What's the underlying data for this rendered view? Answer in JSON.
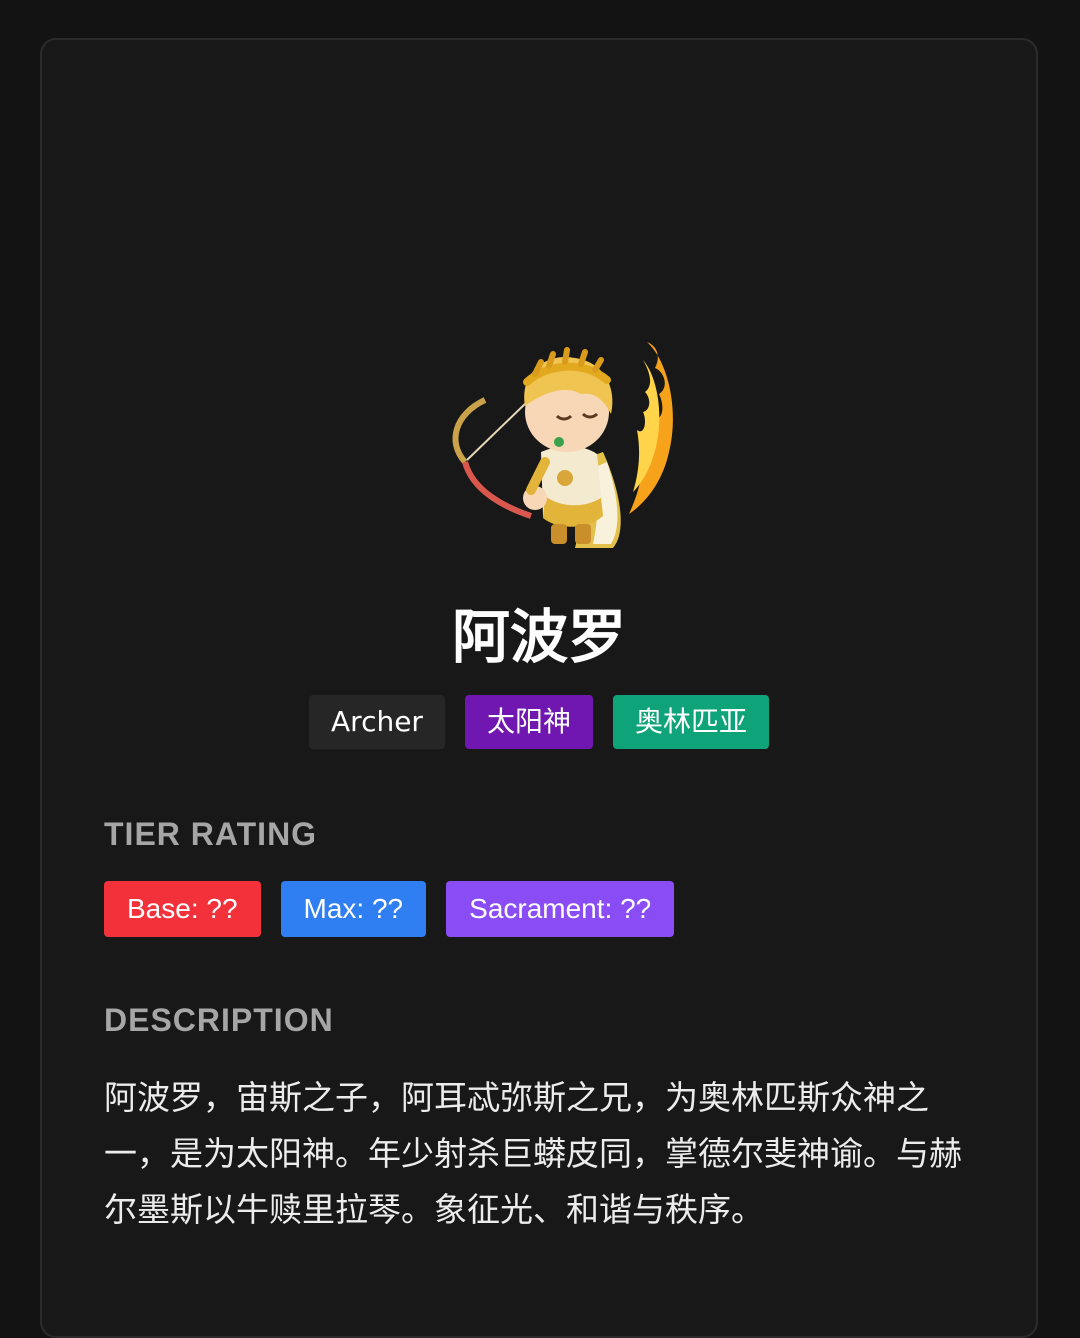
{
  "hero": {
    "name": "阿波罗",
    "portrait_icon": "apollo-archer-portrait-icon"
  },
  "tags": [
    {
      "label": "Archer",
      "color": "#262626"
    },
    {
      "label": "太阳神",
      "color": "#6f17b0"
    },
    {
      "label": "奥林匹亚",
      "color": "#0fa37a"
    }
  ],
  "tier_rating": {
    "title": "TIER RATING",
    "badges": [
      {
        "label": "Base: ??",
        "color": "#f2313a"
      },
      {
        "label": "Max: ??",
        "color": "#2f7ef2"
      },
      {
        "label": "Sacrament: ??",
        "color": "#8a4df5"
      }
    ]
  },
  "description": {
    "title": "DESCRIPTION",
    "text": "阿波罗，宙斯之子，阿耳忒弥斯之兄，为奥林匹斯众神之一，是为太阳神。年少射杀巨蟒皮同，掌德尔斐神谕。与赫尔墨斯以牛赎里拉琴。象征光、和谐与秩序。"
  },
  "colors": {
    "background": "#131313",
    "card": "#181818",
    "card_border": "#2b2b2b",
    "section_title": "#a6a6a6"
  }
}
